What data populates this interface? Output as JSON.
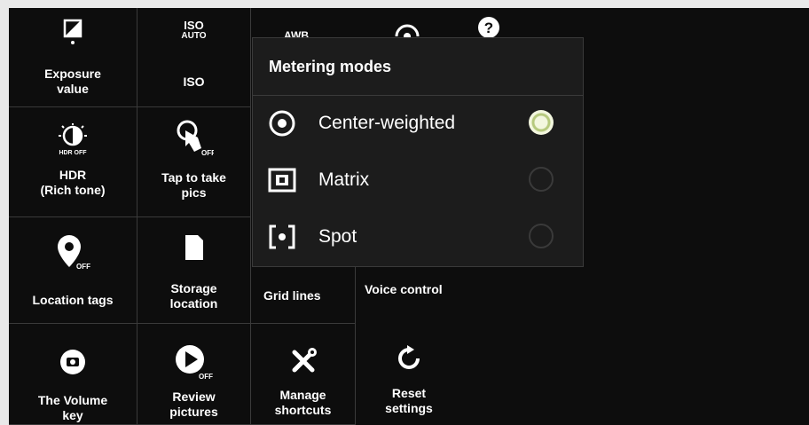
{
  "top_row": {
    "exposure_value": "Exposure\nvalue",
    "iso": "ISO",
    "iso_badge_top": "ISO",
    "iso_badge_bottom": "AUTO",
    "awb": "AWB"
  },
  "tiles": {
    "hdr": "HDR\n(Rich tone)",
    "hdr_badge": "HDR OFF",
    "tap_to_take_pics": "Tap to take\npics",
    "location_tags": "Location tags",
    "storage_location": "Storage\nlocation",
    "grid_lines": "Grid lines",
    "voice_control": "Voice control",
    "volume_key": "The Volume\nkey",
    "review_pictures": "Review\npictures",
    "manage_shortcuts": "Manage\nshortcuts",
    "reset_settings": "Reset\nsettings",
    "off_badge": "OFF"
  },
  "metering_popup": {
    "title": "Metering modes",
    "options": [
      {
        "label": "Center-weighted",
        "selected": true,
        "icon": "center-weighted-icon"
      },
      {
        "label": "Matrix",
        "selected": false,
        "icon": "matrix-icon"
      },
      {
        "label": "Spot",
        "selected": false,
        "icon": "spot-icon"
      }
    ]
  },
  "colors": {
    "background": "#0d0d0d",
    "popup": "#1c1c1c",
    "divider": "#3a3a3a",
    "radio_selected": "#f3f7df"
  }
}
